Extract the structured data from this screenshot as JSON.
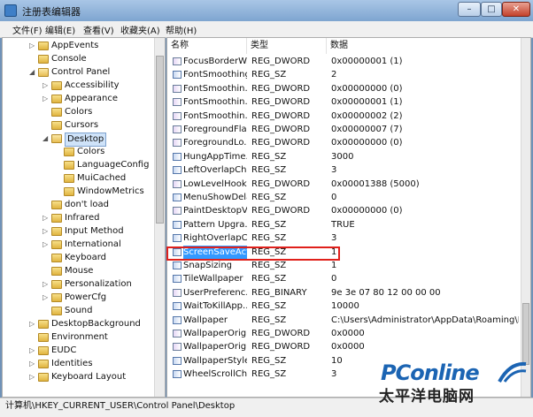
{
  "window": {
    "title": "注册表编辑器",
    "controls": {
      "minimize": "–",
      "maximize": "□",
      "close": "✕"
    }
  },
  "menu": [
    "文件(F)",
    "编辑(E)",
    "查看(V)",
    "收藏夹(A)",
    "帮助(H)"
  ],
  "tree": [
    {
      "label": "AppEvents",
      "level": 1,
      "expander": "▷",
      "open": false,
      "selected": false
    },
    {
      "label": "Console",
      "level": 1,
      "expander": "",
      "open": false,
      "selected": false
    },
    {
      "label": "Control Panel",
      "level": 1,
      "expander": "◢",
      "open": true,
      "selected": false
    },
    {
      "label": "Accessibility",
      "level": 2,
      "expander": "▷",
      "open": false,
      "selected": false
    },
    {
      "label": "Appearance",
      "level": 2,
      "expander": "▷",
      "open": false,
      "selected": false
    },
    {
      "label": "Colors",
      "level": 2,
      "expander": "",
      "open": false,
      "selected": false
    },
    {
      "label": "Cursors",
      "level": 2,
      "expander": "",
      "open": false,
      "selected": false
    },
    {
      "label": "Desktop",
      "level": 2,
      "expander": "◢",
      "open": true,
      "selected": true
    },
    {
      "label": "Colors",
      "level": 3,
      "expander": "",
      "open": false,
      "selected": false
    },
    {
      "label": "LanguageConfig",
      "level": 3,
      "expander": "",
      "open": false,
      "selected": false
    },
    {
      "label": "MuiCached",
      "level": 3,
      "expander": "",
      "open": false,
      "selected": false
    },
    {
      "label": "WindowMetrics",
      "level": 3,
      "expander": "",
      "open": false,
      "selected": false
    },
    {
      "label": "don't load",
      "level": 2,
      "expander": "",
      "open": false,
      "selected": false
    },
    {
      "label": "Infrared",
      "level": 2,
      "expander": "▷",
      "open": false,
      "selected": false
    },
    {
      "label": "Input Method",
      "level": 2,
      "expander": "▷",
      "open": false,
      "selected": false
    },
    {
      "label": "International",
      "level": 2,
      "expander": "▷",
      "open": false,
      "selected": false
    },
    {
      "label": "Keyboard",
      "level": 2,
      "expander": "",
      "open": false,
      "selected": false
    },
    {
      "label": "Mouse",
      "level": 2,
      "expander": "",
      "open": false,
      "selected": false
    },
    {
      "label": "Personalization",
      "level": 2,
      "expander": "▷",
      "open": false,
      "selected": false
    },
    {
      "label": "PowerCfg",
      "level": 2,
      "expander": "▷",
      "open": false,
      "selected": false
    },
    {
      "label": "Sound",
      "level": 2,
      "expander": "",
      "open": false,
      "selected": false
    },
    {
      "label": "DesktopBackground",
      "level": 1,
      "expander": "▷",
      "open": false,
      "selected": false
    },
    {
      "label": "Environment",
      "level": 1,
      "expander": "",
      "open": false,
      "selected": false
    },
    {
      "label": "EUDC",
      "level": 1,
      "expander": "▷",
      "open": false,
      "selected": false
    },
    {
      "label": "Identities",
      "level": 1,
      "expander": "▷",
      "open": false,
      "selected": false
    },
    {
      "label": "Keyboard Layout",
      "level": 1,
      "expander": "▷",
      "open": false,
      "selected": false
    }
  ],
  "columns": {
    "name": "名称",
    "type": "类型",
    "data": "数据"
  },
  "values": [
    {
      "name": "FocusBorderW...",
      "type": "REG_DWORD",
      "data": "0x00000001 (1)",
      "kind": "dword"
    },
    {
      "name": "FontSmoothing",
      "type": "REG_SZ",
      "data": "2",
      "kind": "sz"
    },
    {
      "name": "FontSmoothin...",
      "type": "REG_DWORD",
      "data": "0x00000000 (0)",
      "kind": "dword"
    },
    {
      "name": "FontSmoothin...",
      "type": "REG_DWORD",
      "data": "0x00000001 (1)",
      "kind": "dword"
    },
    {
      "name": "FontSmoothin...",
      "type": "REG_DWORD",
      "data": "0x00000002 (2)",
      "kind": "dword"
    },
    {
      "name": "ForegroundFla...",
      "type": "REG_DWORD",
      "data": "0x00000007 (7)",
      "kind": "dword"
    },
    {
      "name": "ForegroundLo...",
      "type": "REG_DWORD",
      "data": "0x00000000 (0)",
      "kind": "dword"
    },
    {
      "name": "HungAppTime...",
      "type": "REG_SZ",
      "data": "3000",
      "kind": "sz"
    },
    {
      "name": "LeftOverlapCh...",
      "type": "REG_SZ",
      "data": "3",
      "kind": "sz"
    },
    {
      "name": "LowLevelHook...",
      "type": "REG_DWORD",
      "data": "0x00001388 (5000)",
      "kind": "dword"
    },
    {
      "name": "MenuShowDelay",
      "type": "REG_SZ",
      "data": "0",
      "kind": "sz"
    },
    {
      "name": "PaintDesktopV...",
      "type": "REG_DWORD",
      "data": "0x00000000 (0)",
      "kind": "dword"
    },
    {
      "name": "Pattern Upgra...",
      "type": "REG_SZ",
      "data": "TRUE",
      "kind": "sz"
    },
    {
      "name": "RightOverlapC...",
      "type": "REG_SZ",
      "data": "3",
      "kind": "sz"
    },
    {
      "name": "ScreenSaveActi...",
      "type": "REG_SZ",
      "data": "1",
      "kind": "sz",
      "selected": true
    },
    {
      "name": "SnapSizing",
      "type": "REG_SZ",
      "data": "1",
      "kind": "sz"
    },
    {
      "name": "TileWallpaper",
      "type": "REG_SZ",
      "data": "0",
      "kind": "sz"
    },
    {
      "name": "UserPreferenc...",
      "type": "REG_BINARY",
      "data": "9e 3e 07 80 12 00 00 00",
      "kind": "bin"
    },
    {
      "name": "WaitToKillApp...",
      "type": "REG_SZ",
      "data": "10000",
      "kind": "sz"
    },
    {
      "name": "Wallpaper",
      "type": "REG_SZ",
      "data": "C:\\Users\\Administrator\\AppData\\Roaming\\Mi...",
      "kind": "sz"
    },
    {
      "name": "WallpaperOrig...",
      "type": "REG_DWORD",
      "data": "0x0000",
      "kind": "dword"
    },
    {
      "name": "WallpaperOrig...",
      "type": "REG_DWORD",
      "data": "0x0000",
      "kind": "dword"
    },
    {
      "name": "WallpaperStyle",
      "type": "REG_SZ",
      "data": "10",
      "kind": "sz"
    },
    {
      "name": "WheelScrollCh...",
      "type": "REG_SZ",
      "data": "3",
      "kind": "sz"
    }
  ],
  "status": "计算机\\HKEY_CURRENT_USER\\Control Panel\\Desktop",
  "watermark": {
    "line1": "PConline",
    "line2": "太平洋电脑网"
  },
  "colors": {
    "selection": "#3399ff",
    "highlight": "#e0201b",
    "watermark": "#1b64b3"
  }
}
